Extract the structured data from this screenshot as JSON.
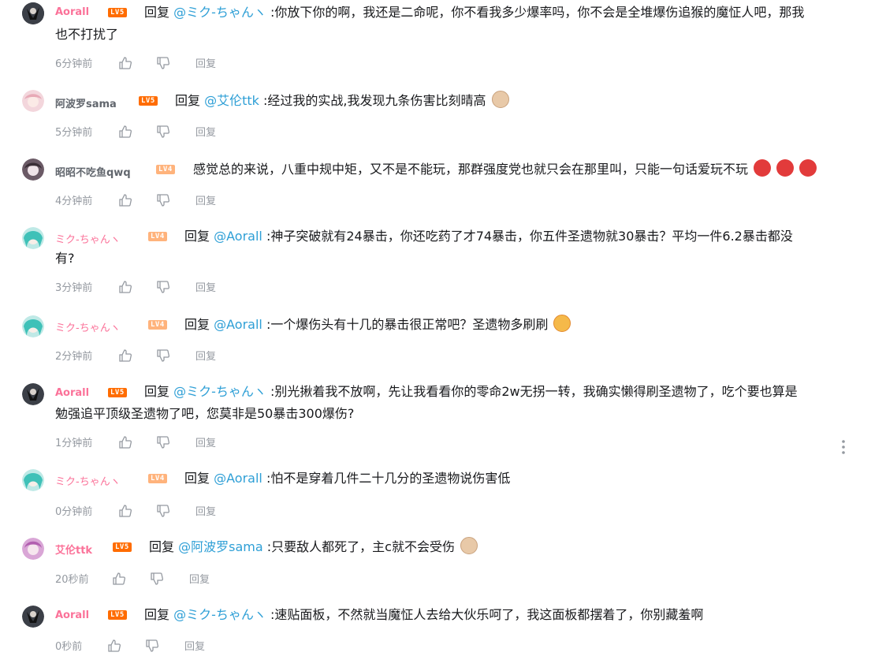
{
  "reply_prefix": "回复",
  "like_icon": "thumbs-up-icon",
  "dislike_icon": "thumbs-down-icon",
  "more_icon": "more-vertical-icon",
  "replies": [
    {
      "user": "Aorall",
      "user_color": "#fb7299",
      "level": "LV5",
      "reply": true,
      "at": "@ミク-ちゃんヽ",
      "text": ":你放下你的啊，我还是二命呢，你不看我多少爆率吗，你不会是全堆爆伤追猴的魔怔人吧，那我",
      "text2": "也不打扰了",
      "time": "6分钟前",
      "action": "回复",
      "emojis": []
    },
    {
      "user": "阿波罗sama",
      "user_color": "#61666d",
      "level": "LV5",
      "reply": true,
      "at": "@艾伦ttk",
      "text": ":经过我的实战,我发现九条伤害比刻晴高",
      "text2": "",
      "time": "5分钟前",
      "action": "回复",
      "emojis": [
        "dog-emoji"
      ]
    },
    {
      "user": "昭昭不吃鱼qwq",
      "user_color": "#61666d",
      "level": "LV4",
      "reply": false,
      "at": "",
      "text": "感觉总的来说，八重中规中矩，又不是不能玩，那群强度党也就只会在那里叫，只能一句话爱玩不玩",
      "text2": "",
      "time": "4分钟前",
      "action": "回复",
      "emojis": [
        "angry-emoji",
        "angry-emoji",
        "angry-emoji"
      ]
    },
    {
      "user": "ミク-ちゃんヽ",
      "user_color": "#fb7299",
      "level": "LV4",
      "reply": true,
      "at": "@Aorall",
      "text": ":神子突破就有24暴击，你还吃药了才74暴击，你五件圣遗物就30暴击？平均一件6.2暴击都没",
      "text2": "有?",
      "time": "3分钟前",
      "action": "回复",
      "emojis": []
    },
    {
      "user": "ミク-ちゃんヽ",
      "user_color": "#fb7299",
      "level": "LV4",
      "reply": true,
      "at": "@Aorall",
      "text": ":一个爆伤头有十几的暴击很正常吧？圣遗物多刷刷",
      "text2": "",
      "time": "2分钟前",
      "action": "回复",
      "emojis": [
        "heart-eyes-emoji"
      ]
    },
    {
      "user": "Aorall",
      "user_color": "#fb7299",
      "level": "LV5",
      "reply": true,
      "at": "@ミク-ちゃんヽ",
      "text": ":别光揪着我不放啊，先让我看看你的零命2w无拐一转，我确实懒得刷圣遗物了，吃个要也算是",
      "text2": "勉强追平顶级圣遗物了吧，您莫非是50暴击300爆伤?",
      "time": "1分钟前",
      "action": "回复",
      "emojis": []
    },
    {
      "user": "ミク-ちゃんヽ",
      "user_color": "#fb7299",
      "level": "LV4",
      "reply": true,
      "at": "@Aorall",
      "text": ":怕不是穿着几件二十几分的圣遗物说伤害低",
      "text2": "",
      "time": "0分钟前",
      "action": "回复",
      "emojis": []
    },
    {
      "user": "艾伦ttk",
      "user_color": "#fb7299",
      "level": "LV5",
      "reply": true,
      "at": "@阿波罗sama",
      "text": ":只要敌人都死了，主c就不会受伤",
      "text2": "",
      "time": "20秒前",
      "action": "回复",
      "emojis": [
        "dog-emoji"
      ]
    },
    {
      "user": "Aorall",
      "user_color": "#fb7299",
      "level": "LV5",
      "reply": true,
      "at": "@ミク-ちゃんヽ",
      "text": ":速贴面板，不然就当魔怔人去给大伙乐呵了，我这面板都摆着了，你别藏羞啊",
      "text2": "",
      "time": "0秒前",
      "action": "回复",
      "emojis": []
    }
  ]
}
